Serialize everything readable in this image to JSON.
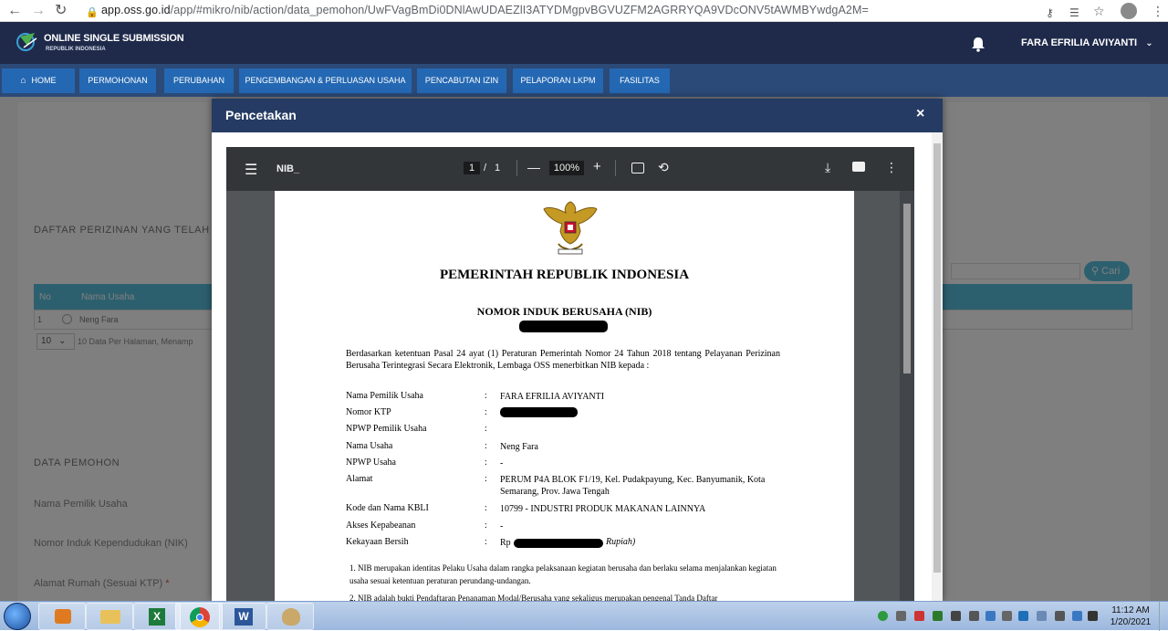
{
  "browser": {
    "url_host": "app.oss.go.id",
    "url_path": "/app/#mikro/nib/action/data_pemohon/UwFVagBmDi0DNlAwUDAEZlI3ATYDMgpvBGVUZFM2AGRRYQA9VDcONV5tAWMBYwdgA2M="
  },
  "header": {
    "brand_title": "ONLINE SINGLE SUBMISSION",
    "brand_subtitle": "REPUBLIK INDONESIA",
    "user_name": "FARA EFRILIA AVIYANTI"
  },
  "nav": {
    "home": "HOME",
    "items": [
      "PERMOHONAN",
      "PERUBAHAN",
      "PENGEMBANGAN & PERLUASAN USAHA",
      "PENCABUTAN IZIN",
      "PELAPORAN LKPM",
      "FASILITAS"
    ]
  },
  "background_page": {
    "section1_title": "DAFTAR PERIZINAN YANG TELAH",
    "table_headers": [
      "No",
      "Nama Usaha"
    ],
    "table_row": {
      "no": "1",
      "nama": "Neng Fara"
    },
    "per_page_value": "10",
    "per_page_text": "10 Data Per Halaman, Menamp",
    "search_button": "Cari",
    "section2_title": "DATA PEMOHON",
    "fields": [
      "Nama Pemilik Usaha",
      "Nomor Induk Kependudukan (NIK)",
      "Alamat Rumah (Sesuai KTP)"
    ],
    "required_mark": "*"
  },
  "modal": {
    "title": "Pencetakan",
    "close_label": "×"
  },
  "pdf_viewer": {
    "filename": "NIB_",
    "page_current": "1",
    "page_separator": "/",
    "page_total": "1",
    "zoom": "100%",
    "zoom_out": "—",
    "zoom_in": "+"
  },
  "document": {
    "heading": "PEMERINTAH REPUBLIK INDONESIA",
    "subheading": "NOMOR INDUK BERUSAHA (NIB)",
    "intro": "Berdasarkan ketentuan Pasal 24 ayat (1) Peraturan Pemerintah Nomor 24 Tahun 2018 tentang Pelayanan Perizinan Berusaha Terintegrasi Secara Elektronik, Lembaga OSS menerbitkan NIB kepada :",
    "rows": [
      {
        "label": "Nama Pemilik Usaha",
        "value": "FARA EFRILIA AVIYANTI"
      },
      {
        "label": "Nomor KTP",
        "value": ""
      },
      {
        "label": "NPWP Pemilik Usaha",
        "value": ""
      },
      {
        "label": "Nama Usaha",
        "value": "Neng Fara"
      },
      {
        "label": "NPWP Usaha",
        "value": "-"
      },
      {
        "label": "Alamat",
        "value": "PERUM P4A BLOK F1/19, Kel. Pudakpayung, Kec. Banyumanik, Kota Semarang, Prov. Jawa Tengah"
      },
      {
        "label": "Kode dan Nama KBLI",
        "value": "10799 - INDUSTRI PRODUK MAKANAN LAINNYA"
      },
      {
        "label": "Akses Kepabeanan",
        "value": "-"
      },
      {
        "label": "Kekayaan Bersih",
        "value": "Rp"
      }
    ],
    "colon": ":",
    "rupiah_suffix": "Rupiah)",
    "note1": "1. NIB merupakan identitas Pelaku Usaha dalam rangka pelaksanaan kegiatan berusaha dan berlaku selama menjalankan kegiatan usaha sesuai ketentuan peraturan perundang-undangan.",
    "note2_partial": "2. NIB adalah bukti Pendaftaran Penanaman Modal/Berusaha yang sekaligus merupakan pengenal Tanda Daftar"
  },
  "taskbar": {
    "time": "11:12 AM",
    "date": "1/20/2021"
  },
  "colors": {
    "header_bg": "#1f2a4a",
    "nav_bg": "#2c4a77",
    "nav_button": "#2468b3",
    "modal_header": "#253b63",
    "pdf_toolbar": "#323639"
  }
}
